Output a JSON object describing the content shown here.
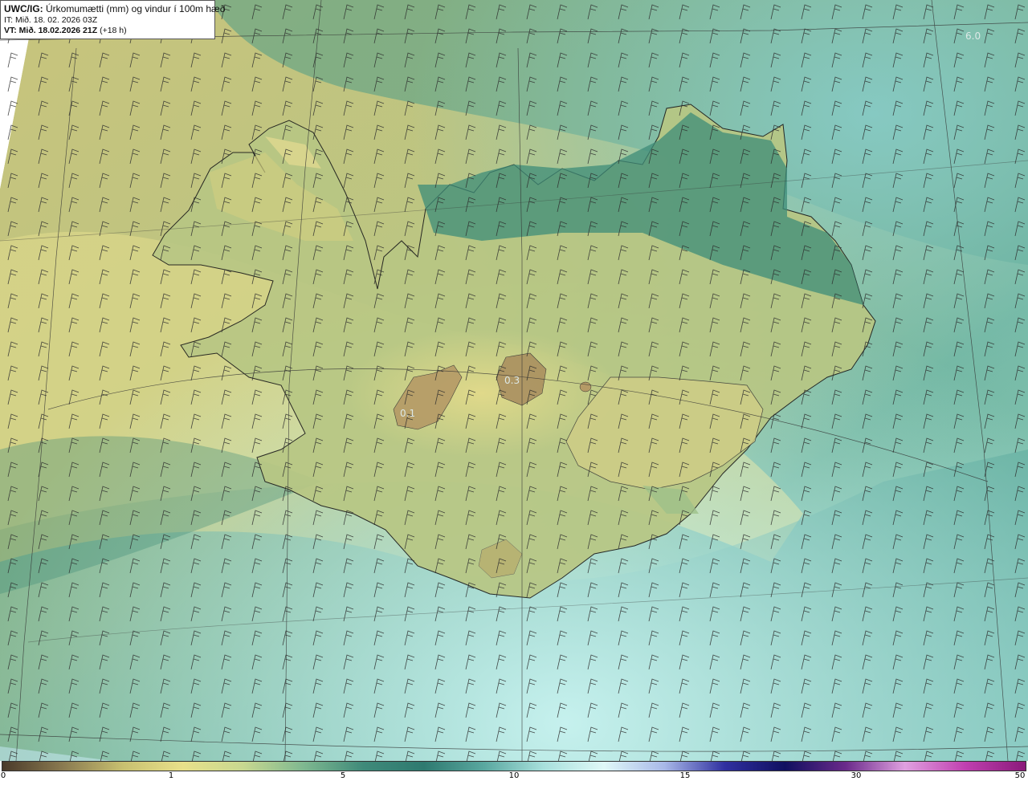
{
  "header": {
    "product": "UWC/IG:",
    "title": "Úrkomumætti (mm) og vindur í 100m hæð",
    "init_time": "IT: Mið. 18. 02. 2026 03Z",
    "valid_label": "VT: Mið. 18.02.2026 21Z",
    "lead_time": "(+18 h)"
  },
  "map_labels": {
    "max_value": "6.0",
    "min_value_1": "0.3",
    "min_value_2": "0.1"
  },
  "colorbar": {
    "ticks": [
      "0",
      "1",
      "5",
      "10",
      "15",
      "30",
      "50"
    ],
    "colors": [
      "#4a3a2a",
      "#8a7a50",
      "#c8c070",
      "#e8e08a",
      "#c8d890",
      "#7fb890",
      "#3f8a7a",
      "#2e7a70",
      "#5aa8a0",
      "#a8e0dc",
      "#e0f8f8",
      "#a8b8e8",
      "#3030a0",
      "#101060",
      "#6a2a8a",
      "#e0a0e0",
      "#c040b0",
      "#8a1a7a"
    ]
  },
  "map_colors": {
    "sea_south": "#8fd6d2",
    "sea_north": "#66b2a8",
    "land_dry": "#d8d588",
    "land_mid": "#a8c085",
    "mountain_wet": "#3e8e79",
    "glacier_dry": "#b59a6a"
  }
}
